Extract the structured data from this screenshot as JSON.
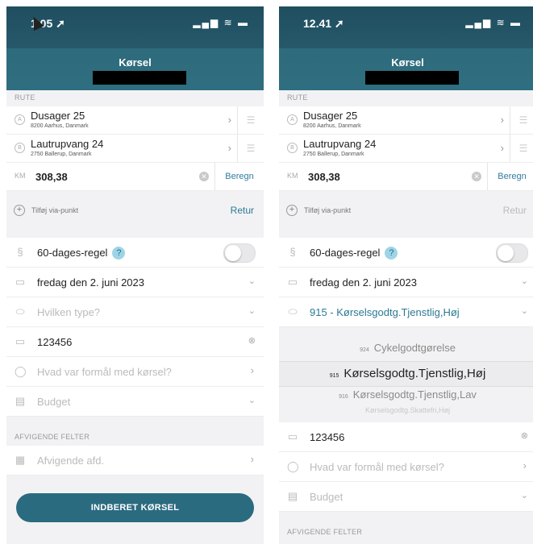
{
  "left": {
    "status": {
      "time": "1.05 ➚",
      "icons": "▂▄▆ ≋ ▬"
    },
    "nav": {
      "title": "Kørsel"
    },
    "route": {
      "section": "RUTE",
      "from": {
        "marker": "A",
        "address": "Dusager 25",
        "sub": "8200 Aarhus, Danmark"
      },
      "to": {
        "marker": "B",
        "address": "Lautrupvang 24",
        "sub": "2750 Ballerup, Danmark"
      }
    },
    "km": {
      "label": "KM",
      "value": "308,38",
      "calc": "Beregn"
    },
    "via": {
      "label": "Tilføj via-punkt",
      "retur": "Retur"
    },
    "rule": {
      "label": "60-dages-regel",
      "help": "?"
    },
    "date": "fredag den 2. juni 2023",
    "type_placeholder": "Hvilken type?",
    "plate": "123456",
    "purpose_placeholder": "Hvad var formål med kørsel?",
    "budget_placeholder": "Budget",
    "deviating": {
      "section": "AFVIGENDE FELTER",
      "dept_placeholder": "Afvigende afd."
    },
    "submit": "INDBERET KØRSEL"
  },
  "right": {
    "status": {
      "time": "12.41 ➚",
      "icons": "▂▄▆ ≋ ▬"
    },
    "nav": {
      "title": "Kørsel"
    },
    "route": {
      "section": "RUTE",
      "from": {
        "marker": "A",
        "address": "Dusager 25",
        "sub": "8200 Aarhus, Danmark"
      },
      "to": {
        "marker": "B",
        "address": "Lautrupvang 24",
        "sub": "2750 Ballerup, Danmark"
      }
    },
    "km": {
      "label": "KM",
      "value": "308,38",
      "calc": "Beregn"
    },
    "via": {
      "label": "Tilføj via-punkt",
      "retur": "Retur"
    },
    "rule": {
      "label": "60-dages-regel",
      "help": "?"
    },
    "date": "fredag den 2. juni 2023",
    "type_value": "915 - Kørselsgodtg.Tjenstlig,Høj",
    "picker": [
      {
        "code": "924",
        "label": "Cykelgodtgørelse"
      },
      {
        "code": "915",
        "label": "Kørselsgodtg.Tjenstlig,Høj"
      },
      {
        "code": "916",
        "label": "Kørselsgodtg.Tjenstlig,Lav"
      },
      {
        "code": "",
        "label": "Kørselsgodtg.Skattefri,Høj"
      }
    ],
    "plate": "123456",
    "purpose_placeholder": "Hvad var formål med kørsel?",
    "budget_placeholder": "Budget",
    "deviating": {
      "section": "AFVIGENDE FELTER"
    }
  },
  "colors": {
    "header": "#2e6b7c",
    "accent": "#2e7da0",
    "button": "#2b6b80"
  }
}
